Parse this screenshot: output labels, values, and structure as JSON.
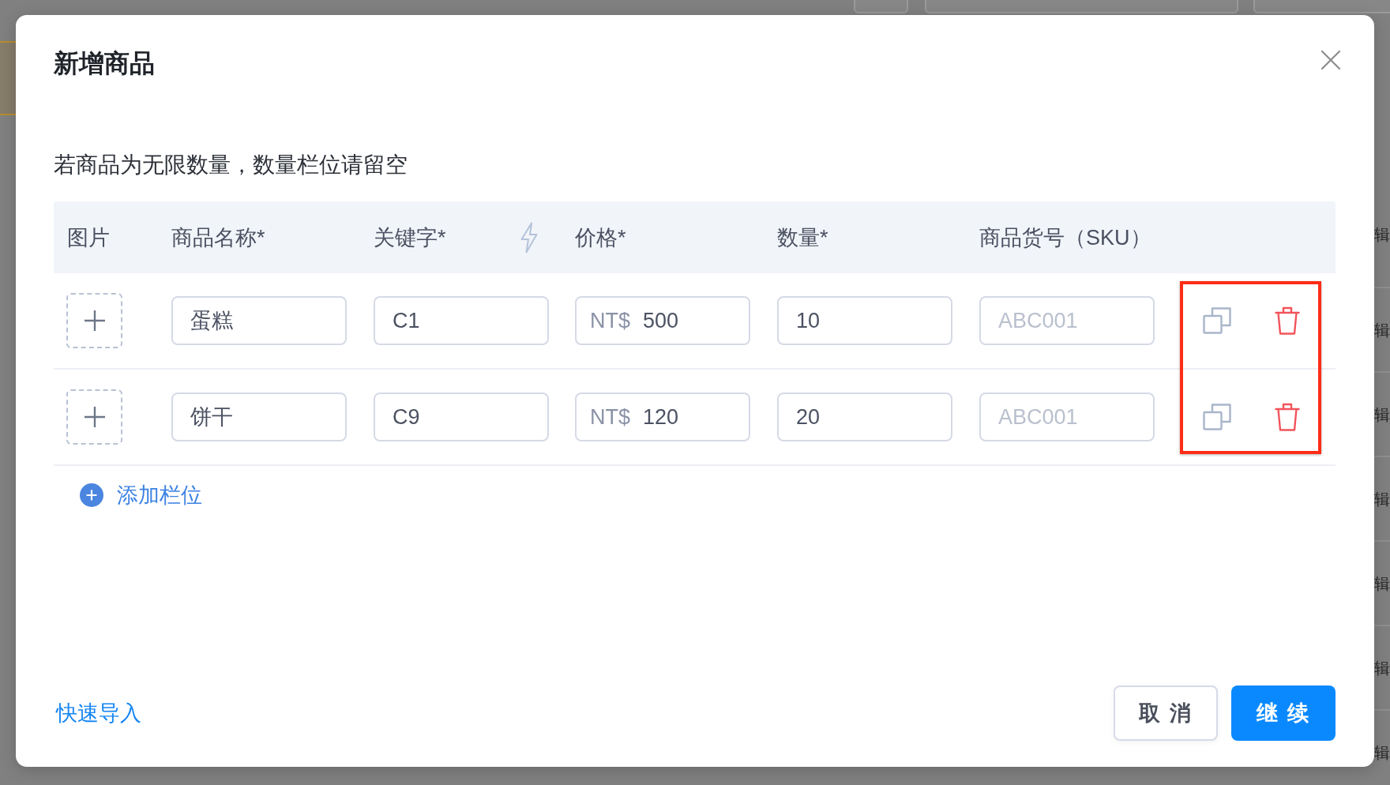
{
  "background": {
    "row_labels": [
      "辑",
      "辑",
      "辑",
      "辑",
      "辑",
      "辑",
      "辑"
    ]
  },
  "dialog": {
    "title": "新增商品",
    "note": "若商品为无限数量，数量栏位请留空",
    "columns": [
      {
        "label": "图片",
        "action_icon": false
      },
      {
        "label": "商品名称*",
        "action_icon": false
      },
      {
        "label": "关键字*",
        "action_icon": true
      },
      {
        "label": "价格*",
        "action_icon": false
      },
      {
        "label": "数量*",
        "action_icon": false
      },
      {
        "label": "商品货号（SKU）",
        "action_icon": false
      }
    ],
    "rows": [
      {
        "name": {
          "value": "蛋糕"
        },
        "keyword": {
          "value": "C1"
        },
        "price": {
          "prefix": "NT$",
          "value": "500"
        },
        "quantity": {
          "value": "10"
        },
        "sku": {
          "placeholder": "ABC001"
        }
      },
      {
        "name": {
          "value": "饼干"
        },
        "keyword": {
          "value": "C9"
        },
        "price": {
          "prefix": "NT$",
          "value": "120"
        },
        "quantity": {
          "value": "20"
        },
        "sku": {
          "placeholder": "ABC001"
        }
      }
    ],
    "add_row": "添加栏位",
    "actions_highlighted": true
  },
  "footer": {
    "link": "快速导入",
    "buttons": [
      {
        "label": "取 消",
        "kind": "secondary"
      },
      {
        "label": "继 续",
        "kind": "primary"
      }
    ]
  }
}
